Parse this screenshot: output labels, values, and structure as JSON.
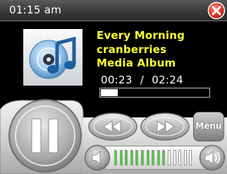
{
  "status": {
    "time": "01:15 am"
  },
  "track": {
    "title": "Every Morning",
    "artist": "cranberries",
    "album": "Media Album",
    "elapsed": "00:23",
    "separator": "/",
    "duration": "02:24",
    "progress_fraction": 0.16
  },
  "controls": {
    "play_pause_icon": "pause-icon",
    "rewind_icon": "rewind-icon",
    "forward_icon": "fast-forward-icon",
    "menu_label": "Menu",
    "volume_down_icon": "volume-down-icon",
    "volume_up_icon": "volume-up-icon",
    "volume_level_bars": 10,
    "volume_total_bars": 15
  },
  "colors": {
    "track_text": "#ffff33",
    "close_red": "#e03a2c",
    "volume_active": "#3fd62e",
    "volume_inactive": "#ffffff"
  }
}
